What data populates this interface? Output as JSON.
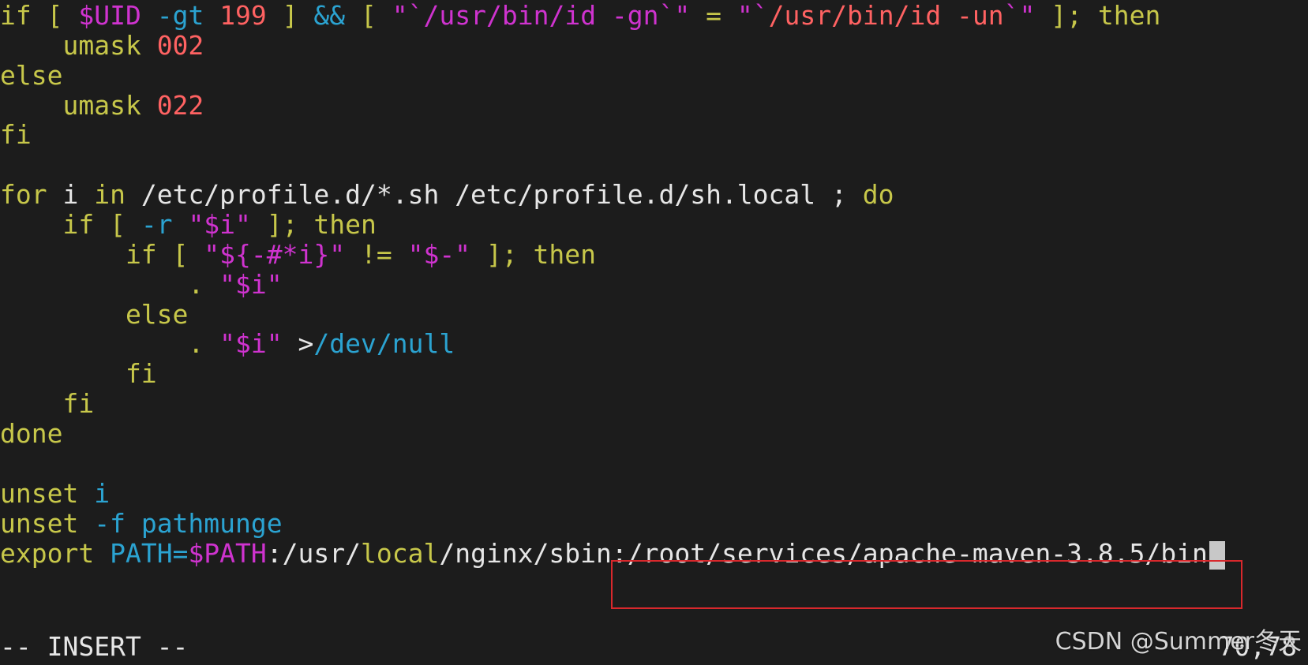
{
  "editor": {
    "lines": [
      {
        "segments": [
          {
            "text": "if [ ",
            "role": "kw"
          },
          {
            "text": "$UID",
            "role": "var"
          },
          {
            "text": " ",
            "role": "txt"
          },
          {
            "text": "-gt",
            "role": "opt"
          },
          {
            "text": " ",
            "role": "txt"
          },
          {
            "text": "199",
            "role": "num"
          },
          {
            "text": " ] ",
            "role": "kw"
          },
          {
            "text": "&&",
            "role": "opt"
          },
          {
            "text": " [ ",
            "role": "kw"
          },
          {
            "text": "\"`",
            "role": "var"
          },
          {
            "text": "/usr/bin/id -gn",
            "role": "var"
          },
          {
            "text": "`\"",
            "role": "var"
          },
          {
            "text": " = ",
            "role": "kw"
          },
          {
            "text": "\"`",
            "role": "var"
          },
          {
            "text": "/usr/bin/id -un",
            "role": "strred"
          },
          {
            "text": "`\"",
            "role": "var"
          },
          {
            "text": " ]; then",
            "role": "kw"
          }
        ]
      },
      {
        "segments": [
          {
            "text": "    umask ",
            "role": "kw"
          },
          {
            "text": "002",
            "role": "num"
          }
        ]
      },
      {
        "segments": [
          {
            "text": "else",
            "role": "kw"
          }
        ]
      },
      {
        "segments": [
          {
            "text": "    umask ",
            "role": "kw"
          },
          {
            "text": "022",
            "role": "num"
          }
        ]
      },
      {
        "segments": [
          {
            "text": "fi",
            "role": "kw"
          }
        ]
      },
      {
        "segments": []
      },
      {
        "segments": [
          {
            "text": "for",
            "role": "kw"
          },
          {
            "text": " i ",
            "role": "txt"
          },
          {
            "text": "in",
            "role": "kw"
          },
          {
            "text": " /etc/profile.d/*.sh /etc/profile.d/sh.local ; ",
            "role": "txt"
          },
          {
            "text": "do",
            "role": "kw"
          }
        ]
      },
      {
        "segments": [
          {
            "text": "    if [ ",
            "role": "kw"
          },
          {
            "text": "-r",
            "role": "opt"
          },
          {
            "text": " ",
            "role": "txt"
          },
          {
            "text": "\"$i\"",
            "role": "var"
          },
          {
            "text": " ]; then",
            "role": "kw"
          }
        ]
      },
      {
        "segments": [
          {
            "text": "        if [ ",
            "role": "kw"
          },
          {
            "text": "\"${-#*i}\"",
            "role": "var"
          },
          {
            "text": " != ",
            "role": "kw"
          },
          {
            "text": "\"$-\"",
            "role": "var"
          },
          {
            "text": " ]; then",
            "role": "kw"
          }
        ]
      },
      {
        "segments": [
          {
            "text": "            . ",
            "role": "kw"
          },
          {
            "text": "\"$i\"",
            "role": "var"
          }
        ]
      },
      {
        "segments": [
          {
            "text": "        else",
            "role": "kw"
          }
        ]
      },
      {
        "segments": [
          {
            "text": "            . ",
            "role": "kw"
          },
          {
            "text": "\"$i\"",
            "role": "var"
          },
          {
            "text": " >",
            "role": "txt"
          },
          {
            "text": "/dev/null",
            "role": "opt"
          }
        ]
      },
      {
        "segments": [
          {
            "text": "        fi",
            "role": "kw"
          }
        ]
      },
      {
        "segments": [
          {
            "text": "    fi",
            "role": "kw"
          }
        ]
      },
      {
        "segments": [
          {
            "text": "done",
            "role": "kw"
          }
        ]
      },
      {
        "segments": []
      },
      {
        "segments": [
          {
            "text": "unset",
            "role": "kw"
          },
          {
            "text": " i",
            "role": "opt"
          }
        ]
      },
      {
        "segments": [
          {
            "text": "unset",
            "role": "kw"
          },
          {
            "text": " -f",
            "role": "opt"
          },
          {
            "text": " pathmunge",
            "role": "opt"
          }
        ]
      },
      {
        "segments": [
          {
            "text": "export",
            "role": "kw"
          },
          {
            "text": " PATH=",
            "role": "opt"
          },
          {
            "text": "$PATH",
            "role": "var"
          },
          {
            "text": ":/usr/",
            "role": "txt"
          },
          {
            "text": "local",
            "role": "kw"
          },
          {
            "text": "/nginx/sbin",
            "role": "txt"
          },
          {
            "text": ":/root/services/apache-maven-3.8.5/bin",
            "role": "txt"
          }
        ],
        "cursor": true
      }
    ]
  },
  "status_bar": {
    "mode": "-- INSERT --",
    "position": "70,78"
  },
  "watermark": {
    "text": "CSDN @Summer冬天"
  }
}
